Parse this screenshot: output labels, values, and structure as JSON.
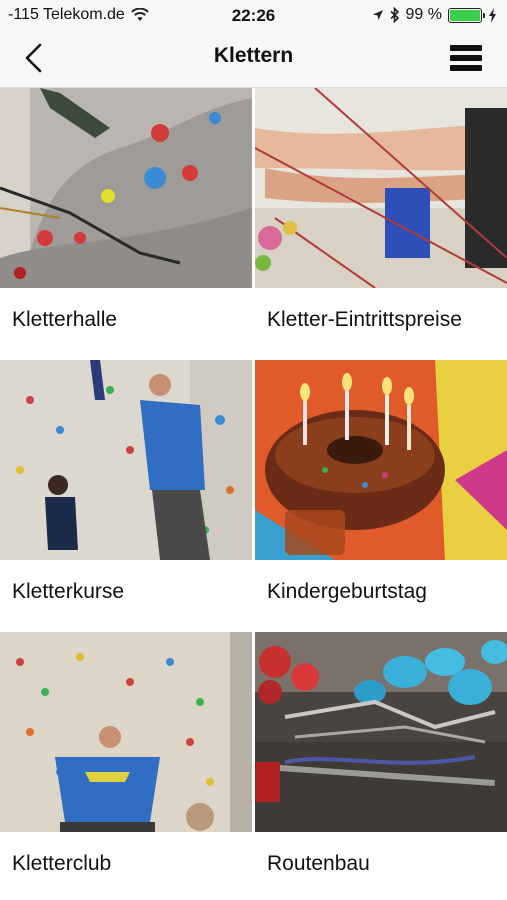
{
  "status_bar": {
    "carrier": "-115 Telekom.de",
    "time": "22:26",
    "battery": "99 %",
    "battery_level": 0.99,
    "icons": [
      "wifi-icon",
      "location-icon",
      "bluetooth-icon",
      "battery-icon",
      "charging-icon"
    ]
  },
  "nav": {
    "title": "Klettern",
    "back_icon": "chevron-left-icon",
    "menu_icon": "hamburger-menu-icon"
  },
  "tiles": [
    {
      "label": "Kletterhalle",
      "image": "climbing-wall-photo"
    },
    {
      "label": "Kletter-Eintrittspreise",
      "image": "rope-belay-photo"
    },
    {
      "label": "Kletterkurse",
      "image": "climbing-course-photo"
    },
    {
      "label": "Kindergeburtstag",
      "image": "birthday-cake-photo"
    },
    {
      "label": "Kletterclub",
      "image": "climbing-club-photo"
    },
    {
      "label": "Routenbau",
      "image": "route-setting-holds-photo"
    }
  ],
  "colors": {
    "bar_background": "#f7f7f7",
    "battery_green": "#38d04a",
    "text": "#111111"
  }
}
